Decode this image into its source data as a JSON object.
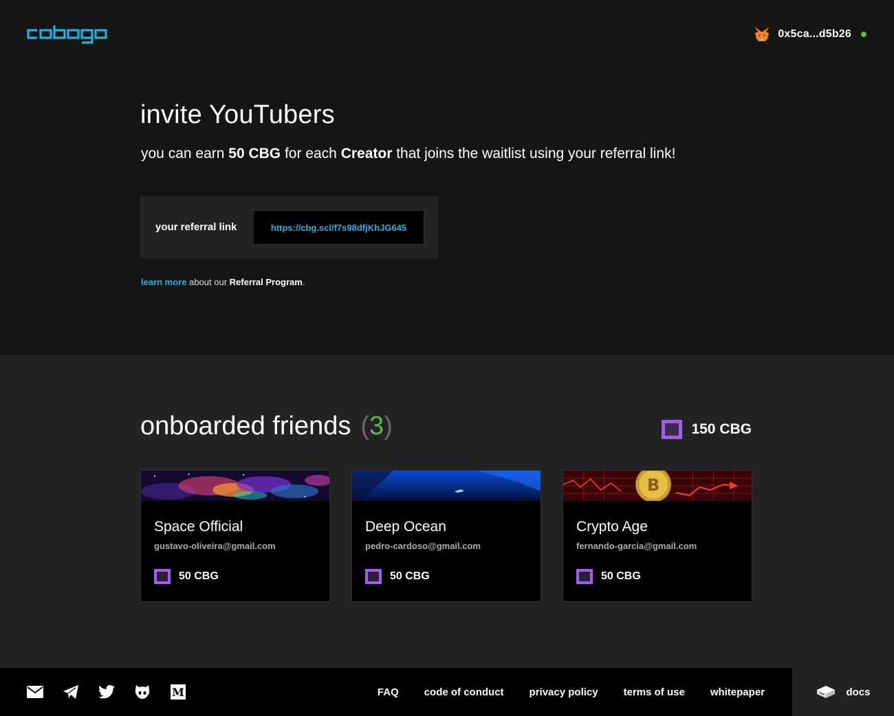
{
  "header": {
    "logo_text": "cobogo",
    "wallet_address": "0x5ca...d5b26"
  },
  "invite": {
    "title": "invite YouTubers",
    "desc_prefix": "you can earn ",
    "desc_amount": "50 CBG",
    "desc_mid": " for each ",
    "desc_role": "Creator",
    "desc_suffix": " that joins the waitlist using your referral link!",
    "ref_label": "your referral link",
    "ref_link": "https://cbg.scl/f7s98dfjKhJG645",
    "learn_more": "learn more",
    "learn_mid": " about our ",
    "learn_program": "Referral Program",
    "learn_end": "."
  },
  "onboarded": {
    "title": "onboarded friends",
    "paren_open": "(",
    "count": "3",
    "paren_close": ")",
    "total": "150 CBG",
    "friends": [
      {
        "name": "Space Official",
        "email": "gustavo-oliveira@gmail.com",
        "reward": "50 CBG"
      },
      {
        "name": "Deep Ocean",
        "email": "pedro-cardoso@gmail.com",
        "reward": "50 CBG"
      },
      {
        "name": "Crypto Age",
        "email": "fernando-garcia@gmail.com",
        "reward": "50 CBG"
      }
    ]
  },
  "footer": {
    "social_icons": [
      "mail-icon",
      "telegram-icon",
      "twitter-icon",
      "github-icon",
      "medium-icon"
    ],
    "links": [
      "FAQ",
      "code of conduct",
      "privacy policy",
      "terms of use",
      "whitepaper"
    ],
    "docs_label": "docs"
  },
  "colors": {
    "accent_blue": "#1fb1e0",
    "token_purple": "#a35bf0",
    "online_green": "#5dbb4a",
    "bg_dark": "#151515",
    "bg_section": "#232323"
  }
}
